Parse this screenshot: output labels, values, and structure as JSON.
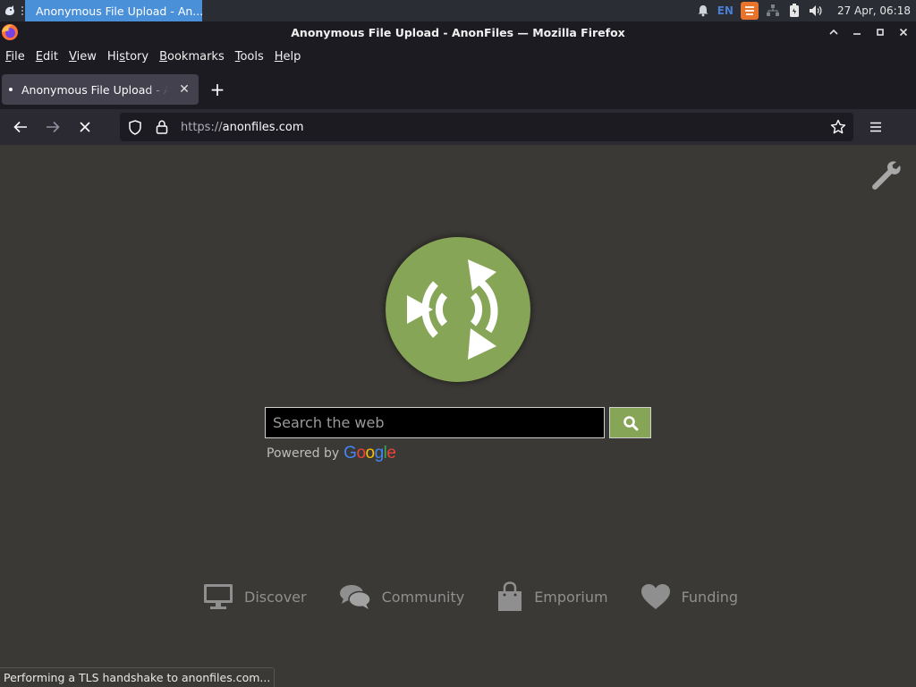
{
  "taskbar": {
    "task_title": "Anonymous File Upload - An...",
    "lang": "EN",
    "clock": "27 Apr, 06:18",
    "icons": [
      "bell-icon",
      "language-indicator",
      "updates-icon",
      "network-icon",
      "battery-icon",
      "volume-icon"
    ]
  },
  "window": {
    "title": "Anonymous File Upload - AnonFiles — Mozilla Firefox"
  },
  "menubar": {
    "items": [
      {
        "label": "File",
        "u": "F",
        "rest": "ile"
      },
      {
        "label": "Edit",
        "u": "E",
        "rest": "dit"
      },
      {
        "label": "View",
        "u": "V",
        "rest": "iew"
      },
      {
        "label": "History",
        "u": "H",
        "rest": "istory",
        "mid": true,
        "pre": "Hi",
        "uc": "s",
        "post": "tory"
      },
      {
        "label": "Bookmarks",
        "u": "B",
        "rest": "ookmarks"
      },
      {
        "label": "Tools",
        "u": "T",
        "rest": "ools"
      },
      {
        "label": "Help",
        "u": "H",
        "rest": "elp"
      }
    ]
  },
  "tab": {
    "title": "Anonymous File Upload - AnonFiles",
    "close_symbol": "✕",
    "new_tab_symbol": "+"
  },
  "navbar": {
    "url_proto": "https://",
    "url_host": "anonfiles.com"
  },
  "page": {
    "search_placeholder": "Search the web",
    "powered_by": "Powered by",
    "google_letters": [
      {
        "ch": "G",
        "color": "#4285F4"
      },
      {
        "ch": "o",
        "color": "#EA4335"
      },
      {
        "ch": "o",
        "color": "#FBBC05"
      },
      {
        "ch": "g",
        "color": "#4285F4"
      },
      {
        "ch": "l",
        "color": "#34A853"
      },
      {
        "ch": "e",
        "color": "#EA4335"
      }
    ],
    "links": [
      {
        "label": "Discover",
        "icon": "monitor-icon"
      },
      {
        "label": "Community",
        "icon": "chat-bubbles-icon"
      },
      {
        "label": "Emporium",
        "icon": "shopping-bag-icon"
      },
      {
        "label": "Funding",
        "icon": "heart-icon"
      }
    ],
    "accent_color": "#87a556"
  },
  "status": {
    "text": "Performing a TLS handshake to anonfiles.com..."
  }
}
